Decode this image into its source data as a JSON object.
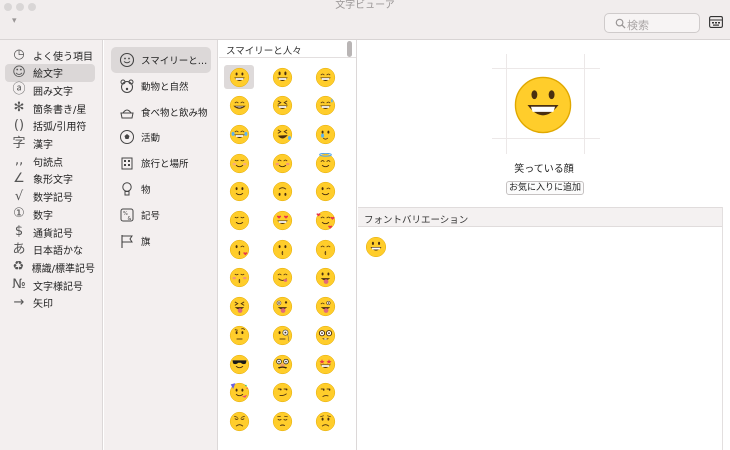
{
  "window": {
    "title": "文字ビューア",
    "view_toggle": "▾"
  },
  "search": {
    "placeholder": "検索",
    "icon": "search-icon"
  },
  "toolbar": {
    "keyboard_icon": "keyboard-viewer-icon"
  },
  "sidebar": {
    "items": [
      {
        "icon": "◷",
        "label": "よく使う項目"
      },
      {
        "icon": "☺",
        "label": "絵文字",
        "selected": true
      },
      {
        "icon": "ⓐ",
        "label": "囲み文字"
      },
      {
        "icon": "✻",
        "label": "箇条書き/星"
      },
      {
        "icon": "()",
        "label": "括弧/引用符"
      },
      {
        "icon": "字",
        "label": "漢字"
      },
      {
        "icon": "‚‚",
        "label": "句読点"
      },
      {
        "icon": "∠",
        "label": "象形文字"
      },
      {
        "icon": "√",
        "label": "数学記号"
      },
      {
        "icon": "①",
        "label": "数字"
      },
      {
        "icon": "$",
        "label": "通貨記号"
      },
      {
        "icon": "あ",
        "label": "日本語かな"
      },
      {
        "icon": "♻",
        "label": "標識/標準記号"
      },
      {
        "icon": "№",
        "label": "文字様記号"
      },
      {
        "icon": "→",
        "label": "矢印"
      }
    ]
  },
  "categories": {
    "items": [
      {
        "icon": "smiley-icon",
        "label": "スマイリーと…",
        "selected": true
      },
      {
        "icon": "bear-icon",
        "label": "動物と自然"
      },
      {
        "icon": "food-icon",
        "label": "食べ物と飲み物"
      },
      {
        "icon": "soccer-ball-icon",
        "label": "活動"
      },
      {
        "icon": "building-icon",
        "label": "旅行と場所"
      },
      {
        "icon": "lightbulb-icon",
        "label": "物"
      },
      {
        "icon": "symbols-icon",
        "label": "記号"
      },
      {
        "icon": "flag-icon",
        "label": "旗"
      }
    ]
  },
  "grid": {
    "header": "スマイリーと人々",
    "emojis": [
      "grinning",
      "smiley",
      "smile",
      "grin",
      "laughing",
      "sweat-smile",
      "joy",
      "rofl",
      "face-holding-tears",
      "relaxed",
      "blush",
      "innocent",
      "slightly-smiling",
      "upside-down",
      "wink",
      "relieved",
      "heart-eyes",
      "smiling-hearts",
      "kissing-heart",
      "kissing",
      "kissing-smiling-eyes",
      "kissing-closed-eyes",
      "yum",
      "tongue",
      "squint-tongue",
      "zany",
      "wink-tongue",
      "raised-eyebrow",
      "monocle",
      "nerd",
      "sunglasses",
      "disguised",
      "star-struck",
      "partying",
      "smirk",
      "unamused",
      "disappointed",
      "pensive",
      "worried"
    ]
  },
  "detail": {
    "selected_emoji": "grinning",
    "name": "笑っている顔",
    "favorite_button": "お気に入りに追加",
    "variations_label": "フォントバリエーション"
  },
  "colors": {
    "emoji_yellow": "#ffcd2b",
    "emoji_dark": "#4a2f10",
    "heart_red": "#e8364a"
  }
}
